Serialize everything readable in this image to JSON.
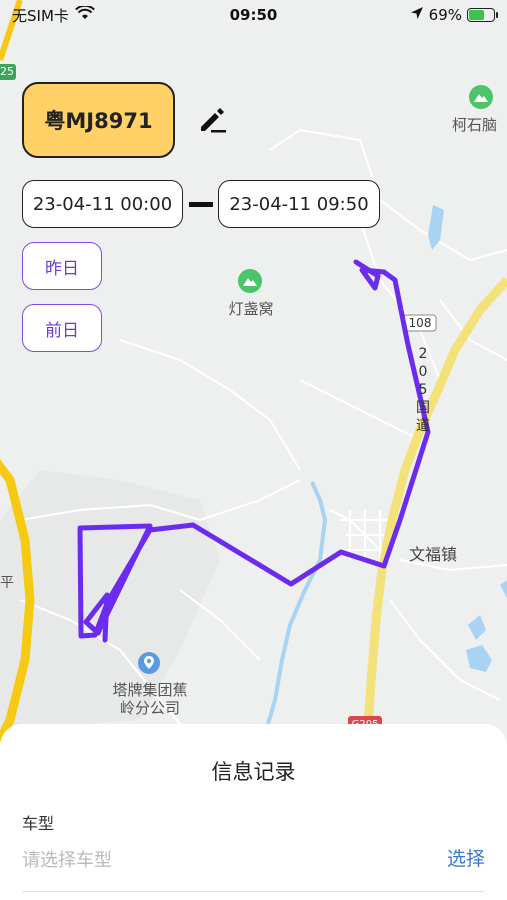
{
  "status_bar": {
    "carrier": "无SIM卡",
    "time": "09:50",
    "battery_percent": "69%",
    "battery_level": 0.69
  },
  "vehicle": {
    "plate": "粤MJ8971"
  },
  "date_range": {
    "start": "23-04-11 00:00",
    "end": "23-04-11 09:50"
  },
  "quick_buttons": {
    "yesterday": "昨日",
    "day_before": "前日"
  },
  "map": {
    "labels": {
      "poi_keshi": "柯石脑",
      "poi_dengzhan": "灯盏窝",
      "road_108": "108",
      "road_205": "2 0 5 国 道",
      "town": "文福镇",
      "poi_tapai_line1": "塔牌集团蕉",
      "poi_tapai_line2": "岭分公司",
      "road_left_25": "25",
      "left_edge_char": "平",
      "road_g205": "G205"
    },
    "colors": {
      "track": "#6b2cf0",
      "highway": "#f6c913",
      "national_road": "#f3e27a",
      "water": "#a9d3f3",
      "poi_green": "#4cc46a",
      "poi_blue": "#5a9be0"
    }
  },
  "info_sheet": {
    "title": "信息记录",
    "vehicle_type_label": "车型",
    "vehicle_type_placeholder": "请选择车型",
    "select_action": "选择"
  },
  "icons": [
    "wifi-icon",
    "location-arrow-icon",
    "battery-icon",
    "edit-pencil-icon",
    "mountain-poi-icon",
    "location-pin-icon"
  ]
}
